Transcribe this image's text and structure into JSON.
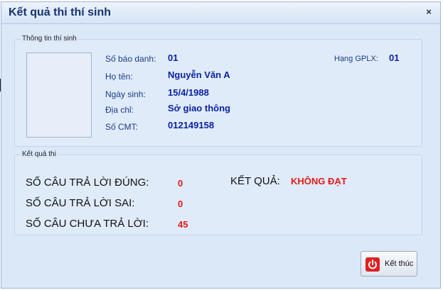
{
  "window": {
    "title": "Kết quả thi thí sinh",
    "close_glyph": "×"
  },
  "info_group": {
    "label": "Thông tin thí sinh",
    "fields": {
      "so_bao_danh": {
        "label": "Số báo danh:",
        "value": "01"
      },
      "ho_ten": {
        "label": "Họ tên:",
        "value": "Nguyễn Văn A"
      },
      "ngay_sinh": {
        "label": "Ngày sinh:",
        "value": "15/4/1988"
      },
      "dia_chi": {
        "label": "Địa chỉ:",
        "value": "Sở giao thông"
      },
      "so_cmt": {
        "label": "Số CMT:",
        "value": "012149158"
      },
      "hang_gplx": {
        "label": "Hạng GPLX:",
        "value": "01"
      }
    }
  },
  "result_group": {
    "label": "Kết quả thi",
    "correct": {
      "label": "SỐ CÂU TRẢ LỜI ĐÚNG:",
      "value": "0"
    },
    "wrong": {
      "label": "SỐ CÂU TRẢ LỜI SAI:",
      "value": "0"
    },
    "unanswered": {
      "label": "SỐ CÂU CHƯA TRẢ LỜI:",
      "value": "45"
    },
    "outcome": {
      "label": "KẾT QUẢ:",
      "value": "KHÔNG ĐẠT"
    }
  },
  "buttons": {
    "finish_label": "Kết thúc"
  },
  "colors": {
    "accent": "#0a1fa3",
    "fail": "#e11a1a",
    "finish_icon": "#e02020"
  }
}
